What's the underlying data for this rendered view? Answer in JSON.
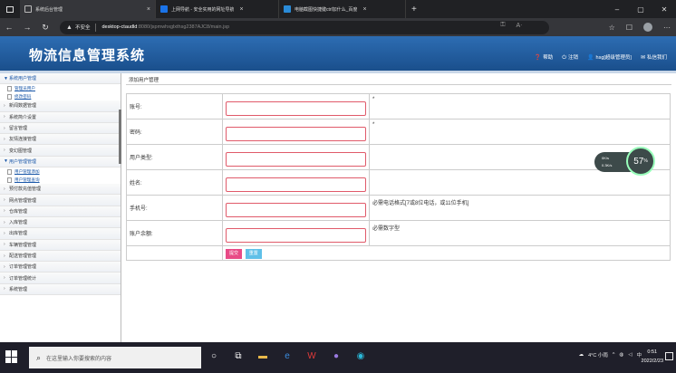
{
  "browser": {
    "tabs": [
      {
        "title": "系统后台管理",
        "favicon": "page-icon",
        "active": true
      },
      {
        "title": "上网导航 - 安全实用的网址导航",
        "favicon": "nav-icon",
        "active": false
      },
      {
        "title": "电脑截图快捷键ctrl加什么_百度",
        "favicon": "baidu-icon",
        "active": false
      }
    ],
    "address": {
      "security_label": "不安全",
      "host": "desktop-ctaudld",
      "path": ":8080/jspmwhxglxthsg2387AJC8/main.jsp"
    }
  },
  "app": {
    "title": "物流信息管理系统",
    "header_links": [
      {
        "icon": "help-icon",
        "label": "帮助"
      },
      {
        "icon": "power-icon",
        "label": "注销"
      },
      {
        "icon": "user-icon",
        "label": "hsg[超级管理员]"
      },
      {
        "icon": "mail-icon",
        "label": "私信我们"
      }
    ]
  },
  "sidebar": {
    "groups": [
      {
        "label": "系统用户管理",
        "open": true,
        "items": [
          "管理员用户",
          "修改密码"
        ]
      },
      {
        "label": "新闻数据管理",
        "open": false,
        "items": []
      },
      {
        "label": "系统简介设置",
        "open": false,
        "items": []
      },
      {
        "label": "留言管理",
        "open": false,
        "items": []
      },
      {
        "label": "友情连接管理",
        "open": false,
        "items": []
      },
      {
        "label": "变幻图管理",
        "open": false,
        "items": []
      },
      {
        "label": "用户管理管理",
        "open": true,
        "items": [
          "用户管理添加",
          "用户管理查询"
        ]
      },
      {
        "label": "预付款充值管理",
        "open": false,
        "items": []
      },
      {
        "label": "网点管理管理",
        "open": false,
        "items": []
      },
      {
        "label": "仓库管理",
        "open": false,
        "items": []
      },
      {
        "label": "入库管理",
        "open": false,
        "items": []
      },
      {
        "label": "出库管理",
        "open": false,
        "items": []
      },
      {
        "label": "车辆管理管理",
        "open": false,
        "items": []
      },
      {
        "label": "配送管理管理",
        "open": false,
        "items": []
      },
      {
        "label": "订单管理管理",
        "open": false,
        "items": []
      },
      {
        "label": "订单管理统计",
        "open": false,
        "items": []
      },
      {
        "label": "系统管理",
        "open": false,
        "items": []
      }
    ]
  },
  "main": {
    "breadcrumb": "添加用户管理",
    "fields": [
      {
        "label": "账号:",
        "hint": "*"
      },
      {
        "label": "密码:",
        "hint": "*"
      },
      {
        "label": "用户类型:",
        "hint": ""
      },
      {
        "label": "姓名:",
        "hint": ""
      },
      {
        "label": "手机号:",
        "hint": "必需电话格式[7或8位电话，或11位手机]"
      },
      {
        "label": "账户余额:",
        "hint": "必需数字型"
      }
    ],
    "submit_label": "提交",
    "reset_label": "重置"
  },
  "widget": {
    "up": "0K/s",
    "down": "0.3K/s",
    "percent": "57"
  },
  "taskbar": {
    "search_placeholder": "在这里输入你要搜索的内容",
    "weather": "4°C 小雨",
    "ime": "中",
    "time": "0:51",
    "date": "2022/2/23"
  }
}
